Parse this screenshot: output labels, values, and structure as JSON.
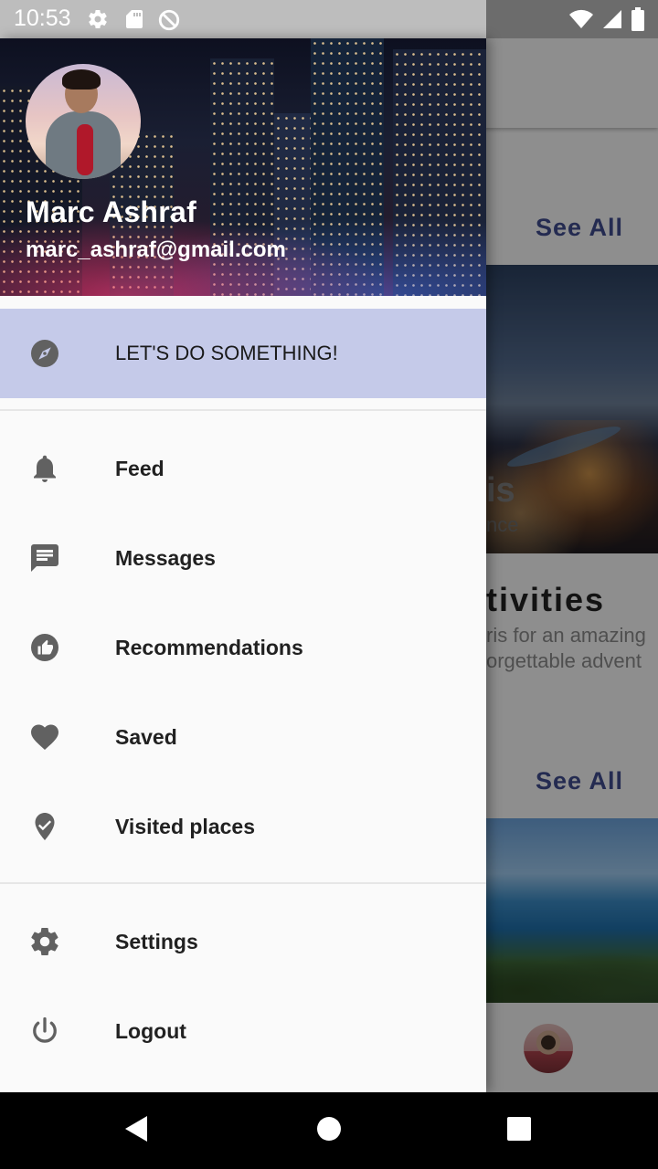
{
  "status_bar": {
    "time": "10:53",
    "left_icons": [
      "settings-icon",
      "sd-card-icon",
      "sync-disabled-icon"
    ],
    "right_icons": [
      "wifi-icon",
      "cell-signal-icon",
      "battery-icon"
    ]
  },
  "drawer": {
    "user": {
      "name": "Marc Ashraf",
      "email": "marc_ashraf@gmail.com"
    },
    "highlight": {
      "label": "LET'S DO SOMETHING!",
      "icon": "compass-icon"
    },
    "items": [
      {
        "label": "Feed",
        "icon": "bell-icon"
      },
      {
        "label": "Messages",
        "icon": "message-icon"
      },
      {
        "label": "Recommendations",
        "icon": "thumb-up-icon"
      },
      {
        "label": "Saved",
        "icon": "heart-icon"
      },
      {
        "label": "Visited places",
        "icon": "place-check-icon"
      }
    ],
    "footer_items": [
      {
        "label": "Settings",
        "icon": "gear-icon"
      },
      {
        "label": "Logout",
        "icon": "power-icon"
      }
    ],
    "accent_color": "#c5cae9"
  },
  "background": {
    "see_all_1": "See All",
    "see_all_2": "See All",
    "card_title_fragment": "is",
    "card_subtitle_fragment": "nce",
    "section_title_fragment": "tivities",
    "section_desc_line1": "ris for an amazing",
    "section_desc_line2": "orgettable advent",
    "accent_color": "#3e4a8c"
  },
  "nav_bar": {
    "buttons": [
      "back-icon",
      "home-icon",
      "recents-icon"
    ]
  }
}
